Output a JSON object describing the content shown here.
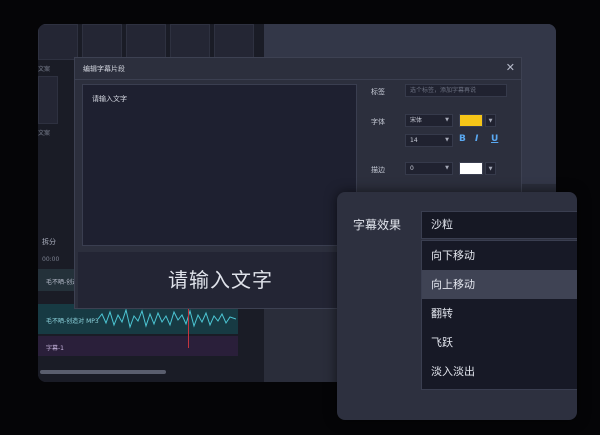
{
  "background": {
    "left_labels": [
      "文案",
      "文案"
    ],
    "track_tool_label": "拆分",
    "timeline_time": "00:00",
    "timeline_rows": [
      "毛不晒-创造...",
      "毛不晒-创造对 MP3",
      "字幕-1"
    ]
  },
  "dialog": {
    "title": "编辑字幕片段",
    "close_icon": "close-icon",
    "text_label": "请输入文字",
    "preview_text": "请输入文字",
    "props": {
      "tag_label": "标签",
      "tag_placeholder": "选个标签，添加字幕再说",
      "font_label": "字体",
      "font_value": "宋体",
      "font_size": "14",
      "font_color": "#f5c518",
      "bold_label": "B",
      "italic_label": "I",
      "underline_label": "U",
      "stroke_label": "描边",
      "stroke_value": "0",
      "stroke_color": "#ffffff"
    }
  },
  "effects": {
    "label": "字幕效果",
    "selected": "沙粒",
    "options": [
      "向下移动",
      "向上移动",
      "翻转",
      "飞跃",
      "淡入淡出"
    ],
    "highlighted_index": 1
  }
}
